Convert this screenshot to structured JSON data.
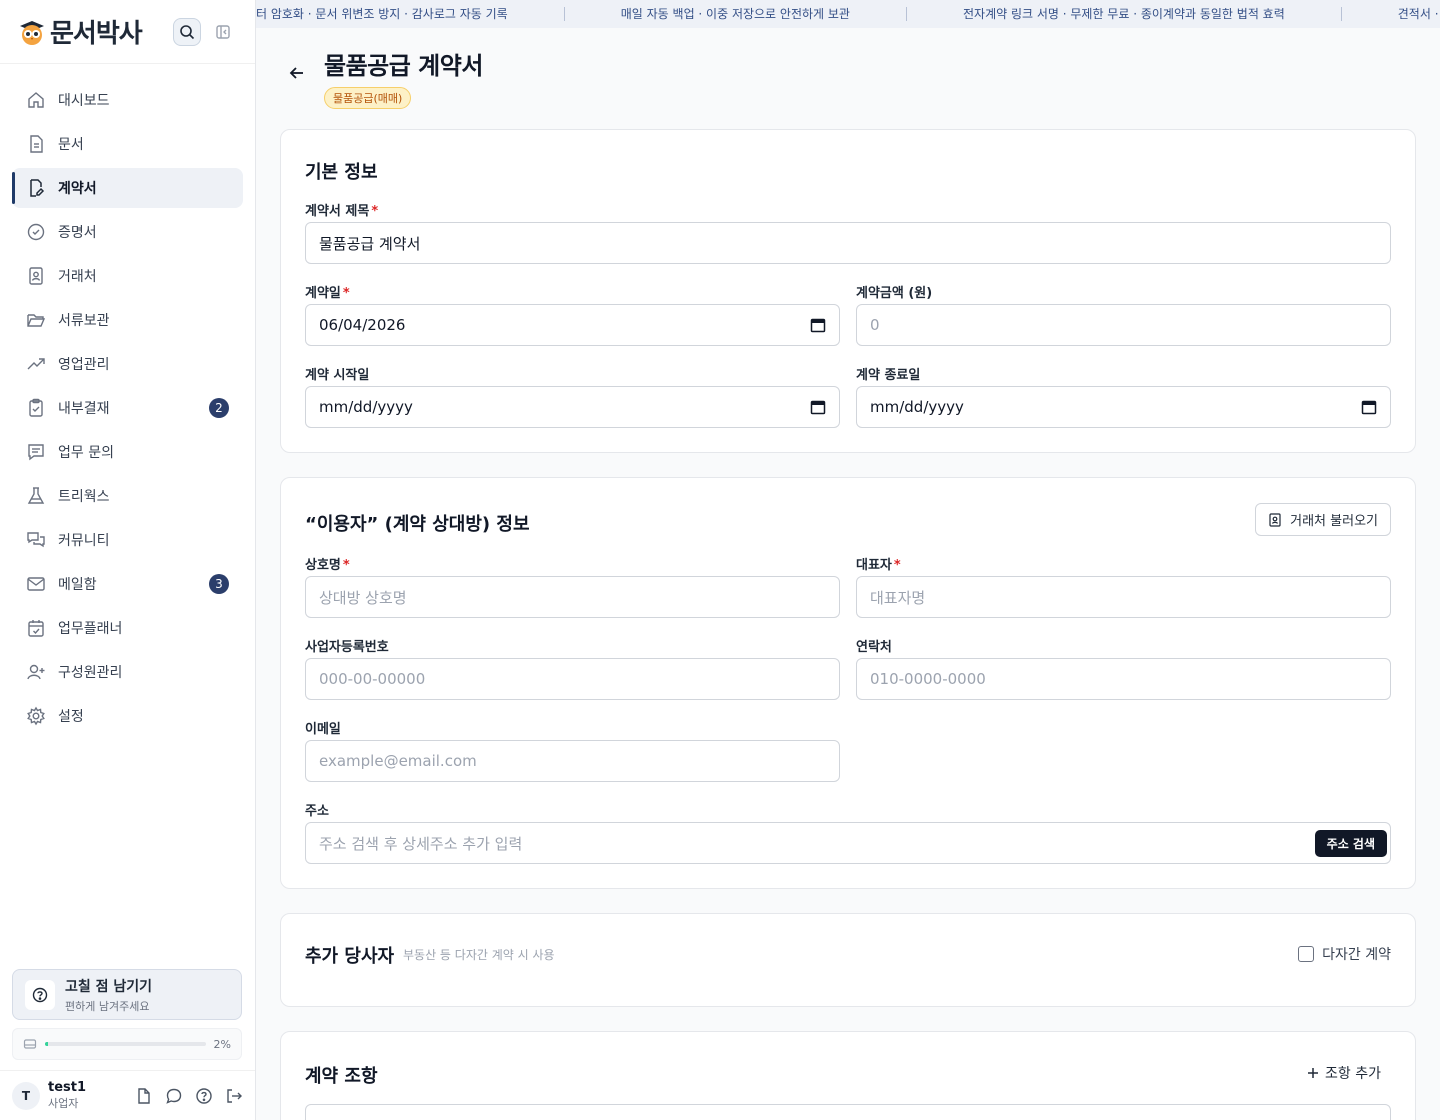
{
  "brand": {
    "name": "문서박사"
  },
  "sidebar": {
    "items": [
      {
        "label": "대시보드"
      },
      {
        "label": "문서"
      },
      {
        "label": "계약서"
      },
      {
        "label": "증명서"
      },
      {
        "label": "거래처"
      },
      {
        "label": "서류보관"
      },
      {
        "label": "영업관리"
      },
      {
        "label": "내부결재",
        "badge": "2"
      },
      {
        "label": "업무 문의"
      },
      {
        "label": "트리웍스"
      },
      {
        "label": "커뮤니티"
      },
      {
        "label": "메일함",
        "badge": "3"
      },
      {
        "label": "업무플래너"
      },
      {
        "label": "구성원관리"
      },
      {
        "label": "설정"
      }
    ],
    "active_index": 2,
    "feedback": {
      "title": "고칠 점 남기기",
      "subtitle": "편하게 남겨주세요"
    },
    "storage": {
      "percent_label": "2%",
      "fraction": 0.02
    },
    "user": {
      "initial": "T",
      "name": "test1",
      "role": "사업자"
    }
  },
  "ticker": {
    "items": [
      "터 암호화 · 문서 위변조 방지 · 감사로그 자동 기록",
      "매일 자동 백업 · 이중 저장으로 안전하게 보관",
      "전자계약 링크 서명 · 무제한 무료 · 종이계약과 동일한 법적 효력",
      "견적서 · 계약서 · 증"
    ]
  },
  "page": {
    "title": "물품공급 계약서",
    "badge": "물품공급(매매)"
  },
  "basic": {
    "title": "기본 정보",
    "contract_title": {
      "label": "계약서 제목",
      "value": "물품공급 계약서"
    },
    "contract_date": {
      "label": "계약일",
      "value": "06/04/2026"
    },
    "amount": {
      "label": "계약금액 (원)",
      "placeholder": "0"
    },
    "start_date": {
      "label": "계약 시작일",
      "value": "mm/dd/yyyy"
    },
    "end_date": {
      "label": "계약 종료일",
      "value": "mm/dd/yyyy"
    }
  },
  "counterparty": {
    "title": "“이용자” (계약 상대방) 정보",
    "load_button": "거래처 불러오기",
    "company": {
      "label": "상호명",
      "placeholder": "상대방 상호명"
    },
    "ceo": {
      "label": "대표자",
      "placeholder": "대표자명"
    },
    "biz_no": {
      "label": "사업자등록번호",
      "placeholder": "000-00-00000"
    },
    "phone": {
      "label": "연락처",
      "placeholder": "010-0000-0000"
    },
    "email": {
      "label": "이메일",
      "placeholder": "example@email.com"
    },
    "address": {
      "label": "주소",
      "placeholder": "주소 검색 후 상세주소 추가 입력",
      "search_button": "주소 검색"
    }
  },
  "parties": {
    "title": "추가 당사자",
    "hint": "부동산 등 다자간 계약 시 사용",
    "checkbox_label": "다자간 계약"
  },
  "clauses": {
    "title": "계약 조항",
    "add_button": "조항 추가"
  }
}
